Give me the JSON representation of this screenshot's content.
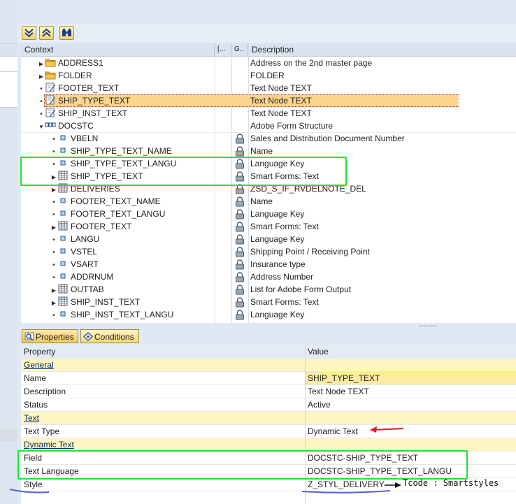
{
  "toolbar": {
    "buttons": [
      {
        "icon": "expand-all-icon"
      },
      {
        "icon": "collapse-all-icon"
      },
      {
        "icon": "find-icon"
      }
    ]
  },
  "tree": {
    "headers": {
      "context": "Context",
      "col2": "[...",
      "col3": "G..",
      "description": "Description"
    },
    "rows": [
      {
        "name": "ADDRESS1",
        "desc": "Address on the 2nd master page",
        "icon": "folder-icon",
        "expander": "collapsed"
      },
      {
        "name": "FOLDER",
        "desc": "FOLDER",
        "icon": "folder-icon",
        "expander": "collapsed"
      },
      {
        "name": "FOOTER_TEXT",
        "desc": "Text Node TEXT",
        "icon": "text-node-icon",
        "expander": "leaf"
      },
      {
        "name": "SHIP_TYPE_TEXT",
        "desc": "Text Node TEXT",
        "icon": "text-node-icon",
        "expander": "leaf",
        "selected": true
      },
      {
        "name": "SHIP_INST_TEXT",
        "desc": "Text Node TEXT",
        "icon": "text-node-icon",
        "expander": "leaf"
      },
      {
        "name": "DOCSTC",
        "desc": "Adobe Form Structure",
        "icon": "structure-icon",
        "expander": "expanded"
      },
      {
        "name": "VBELN",
        "desc": "Sales and Distribution Document Number",
        "icon": "field-icon",
        "expander": "leaf"
      },
      {
        "name": "SHIP_TYPE_TEXT_NAME",
        "desc": "Name",
        "icon": "field-icon",
        "expander": "leaf"
      },
      {
        "name": "SHIP_TYPE_TEXT_LANGU",
        "desc": "Language Key",
        "icon": "field-icon",
        "expander": "leaf"
      },
      {
        "name": "SHIP_TYPE_TEXT",
        "desc": "Smart Forms: Text",
        "icon": "table-icon",
        "expander": "collapsed"
      },
      {
        "name": "DELIVERIES",
        "desc": "ZSD_S_IF_RVDELNOTE_DEL",
        "icon": "table-icon",
        "expander": "collapsed"
      },
      {
        "name": "FOOTER_TEXT_NAME",
        "desc": "Name",
        "icon": "field-icon",
        "expander": "leaf"
      },
      {
        "name": "FOOTER_TEXT_LANGU",
        "desc": "Language Key",
        "icon": "field-icon",
        "expander": "leaf"
      },
      {
        "name": "FOOTER_TEXT",
        "desc": "Smart Forms: Text",
        "icon": "table-icon",
        "expander": "collapsed"
      },
      {
        "name": "LANGU",
        "desc": "Language Key",
        "icon": "field-icon",
        "expander": "leaf"
      },
      {
        "name": "VSTEL",
        "desc": "Shipping Point / Receiving Point",
        "icon": "field-icon",
        "expander": "leaf"
      },
      {
        "name": "VSART",
        "desc": "Insurance type",
        "icon": "field-icon",
        "expander": "leaf"
      },
      {
        "name": "ADDRNUM",
        "desc": "Address Number",
        "icon": "field-icon",
        "expander": "leaf"
      },
      {
        "name": "OUTTAB",
        "desc": "List for Adobe Form Output",
        "icon": "table-icon",
        "expander": "collapsed"
      },
      {
        "name": "SHIP_INST_TEXT",
        "desc": "Smart Forms: Text",
        "icon": "table-icon",
        "expander": "collapsed"
      },
      {
        "name": "SHIP_INST_TEXT_LANGU",
        "desc": "Language Key",
        "icon": "field-icon",
        "expander": "leaf"
      }
    ]
  },
  "tabs": {
    "properties": "Properties",
    "conditions": "Conditions"
  },
  "properties": {
    "col_property": "Property",
    "col_value": "Value",
    "rows": [
      {
        "type": "section",
        "name": "General",
        "value": ""
      },
      {
        "type": "prop",
        "name": "Name",
        "value": "SHIP_TYPE_TEXT",
        "highlight": true
      },
      {
        "type": "prop",
        "name": "Description",
        "value": "Text Node TEXT"
      },
      {
        "type": "prop",
        "name": "Status",
        "value": "Active"
      },
      {
        "type": "section",
        "name": "Text",
        "value": ""
      },
      {
        "type": "prop",
        "name": "Text Type",
        "value": "Dynamic Text"
      },
      {
        "type": "section",
        "name": "Dynamic Text",
        "value": ""
      },
      {
        "type": "prop",
        "name": "Field",
        "value": "DOCSTC-SHIP_TYPE_TEXT"
      },
      {
        "type": "prop",
        "name": "Text Language",
        "value": "DOCSTC-SHIP_TYPE_TEXT_LANGU"
      },
      {
        "type": "prop",
        "name": "Style",
        "value": "Z_STYL_DELIVERY"
      }
    ]
  },
  "annotation": {
    "tcode_note": "Tcode : Smartstyles",
    "green": "#22e332",
    "red": "#e11c1c",
    "blue": "#5466d6"
  }
}
